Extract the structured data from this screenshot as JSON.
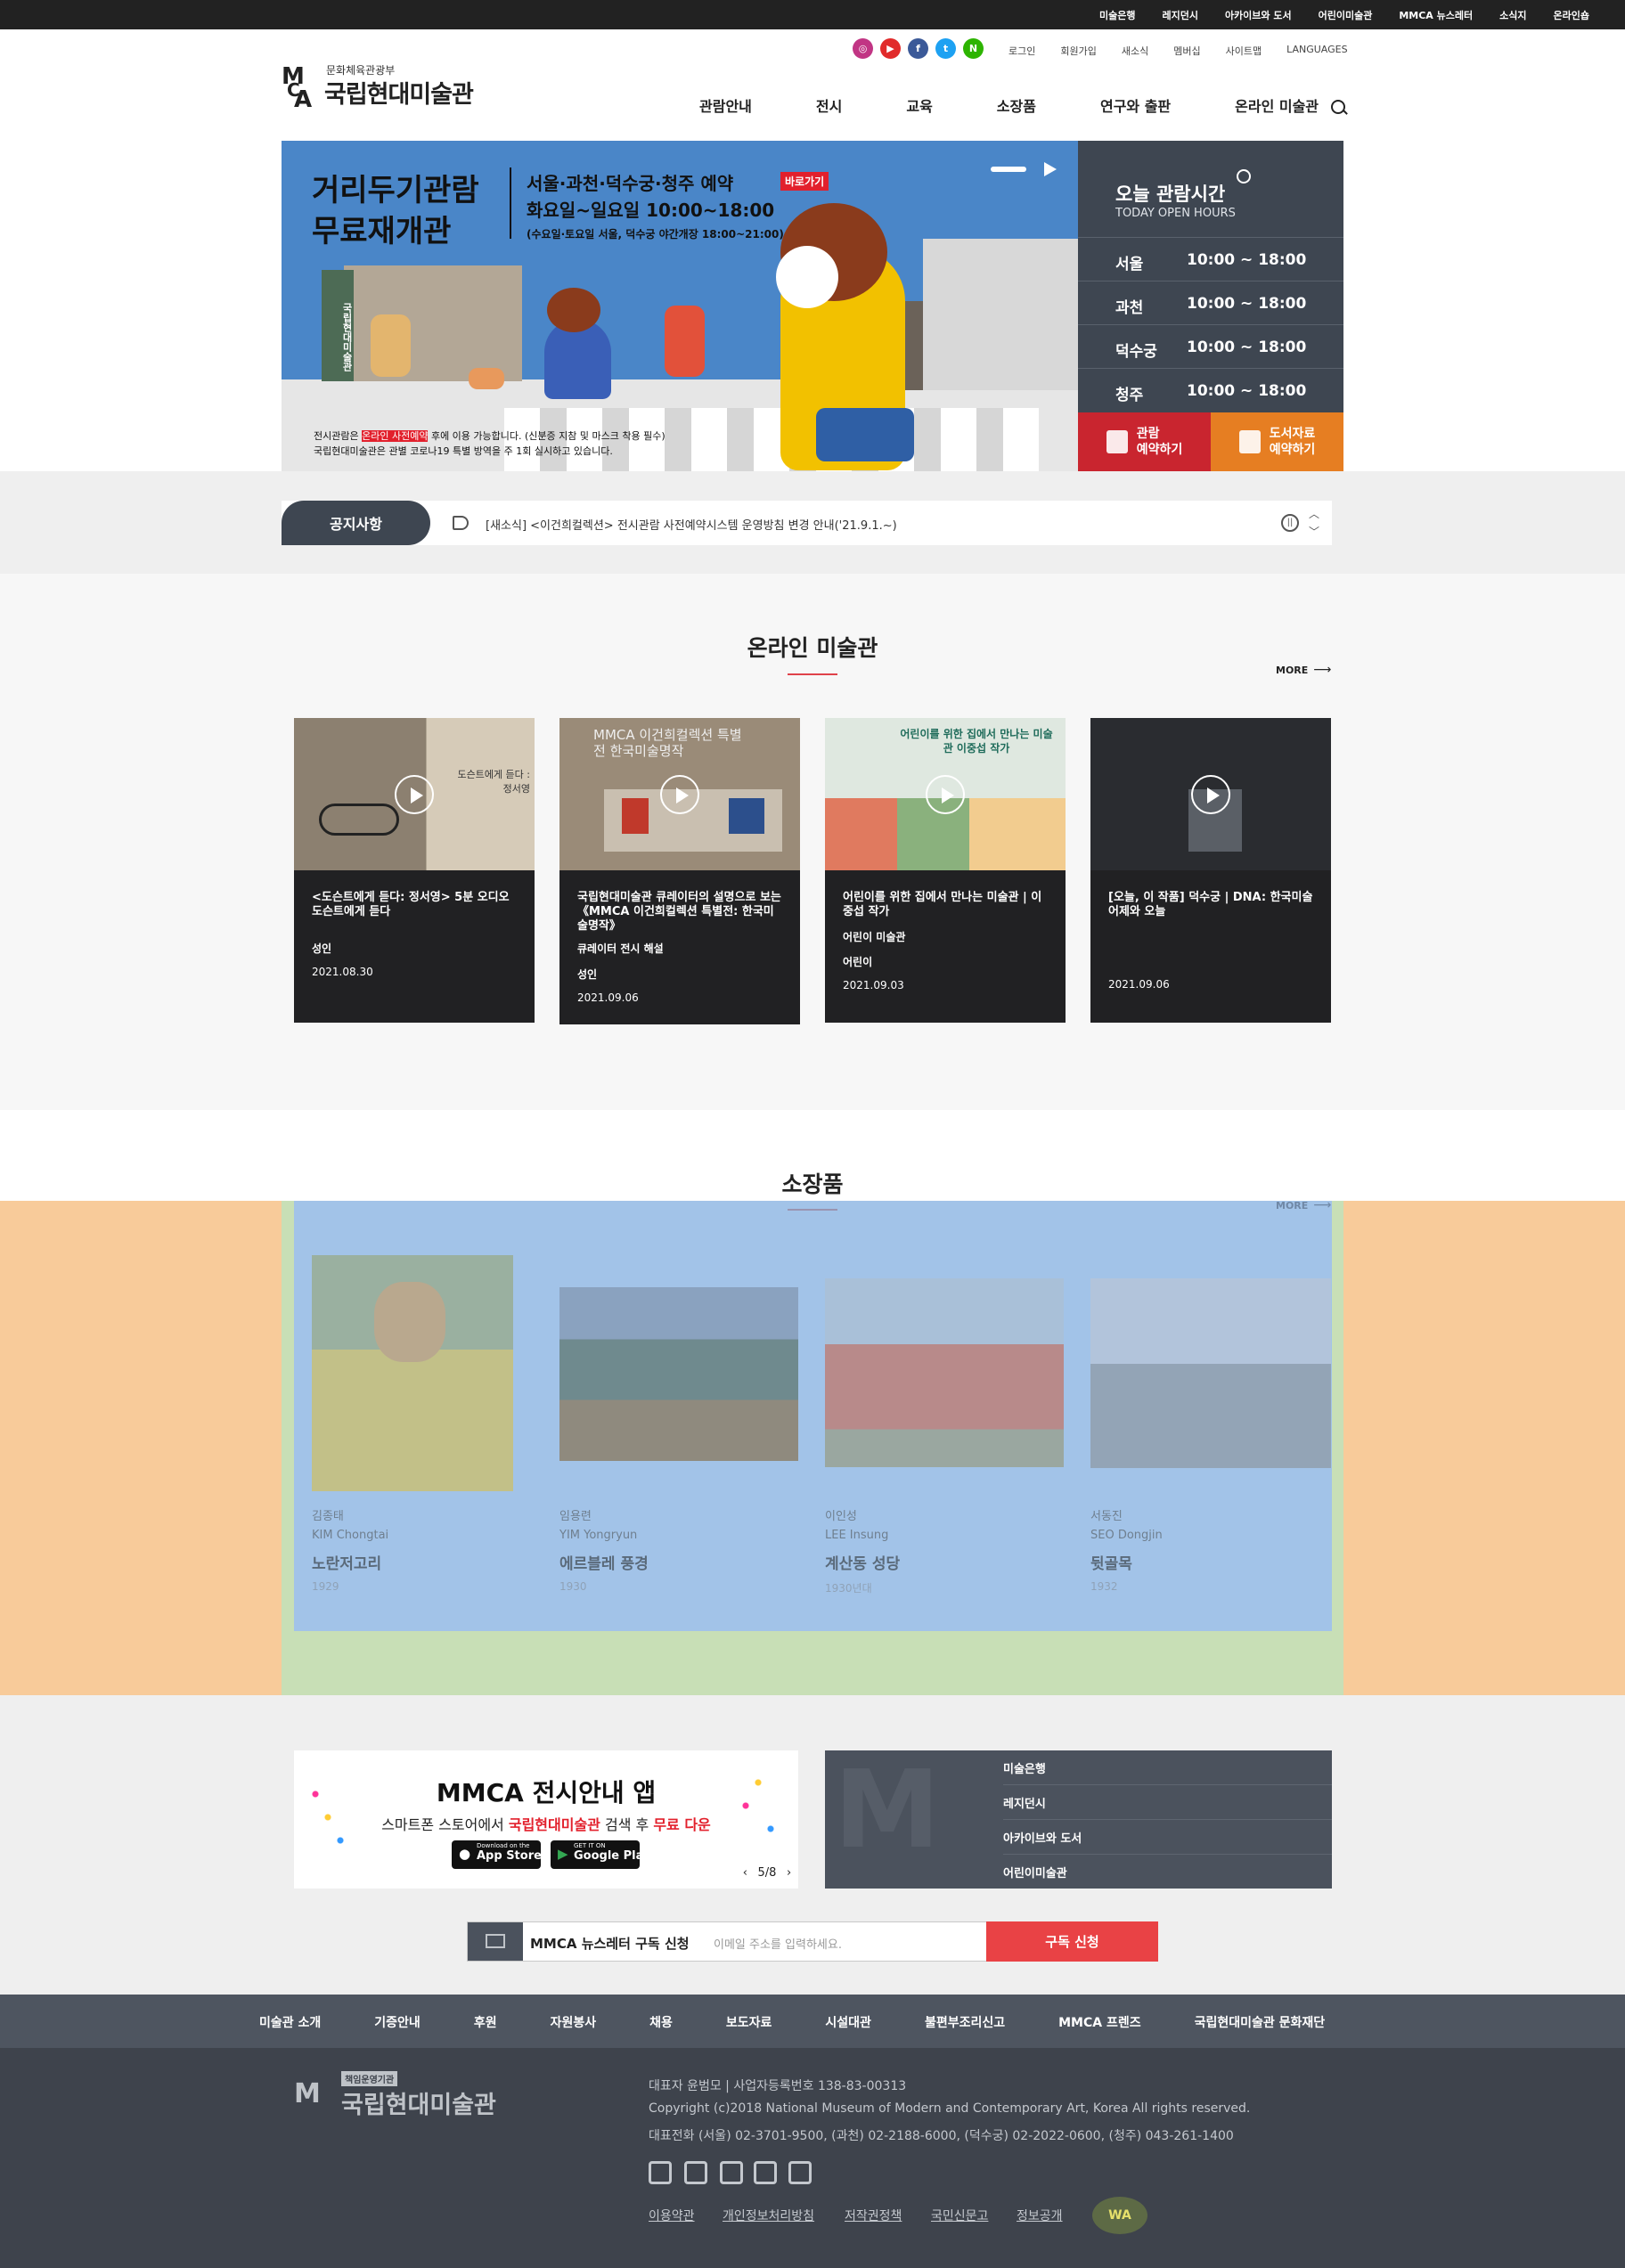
{
  "topbar": {
    "links": [
      "미술은행",
      "레지던시",
      "아카이브와 도서",
      "어린이미술관",
      "MMCA 뉴스레터",
      "소식지",
      "온라인숍"
    ]
  },
  "header": {
    "sns": [
      "instagram-icon",
      "youtube-icon",
      "facebook-icon",
      "twitter-icon",
      "naver-icon"
    ],
    "util": [
      "로그인",
      "회원가입",
      "새소식",
      "멤버십",
      "사이트맵",
      "LANGUAGES"
    ],
    "logo_sub": "문화체육관광부",
    "logo_name": "국립현대미술관",
    "gnb": [
      "관람안내",
      "전시",
      "교육",
      "소장품",
      "연구와 출판",
      "온라인 미술관"
    ]
  },
  "hero": {
    "title_line1": "거리두기관람",
    "title_line2": "무료재개관",
    "venues": "서울·과천·덕수궁·청주 예약",
    "shortcut": "바로가기",
    "days": "화요일~일요일 10:00~18:00",
    "night": "(수요일·토요일 서울, 덕수궁 야간개장 18:00~21:00)",
    "note1_a": "전시관람은 ",
    "note1_hl": "온라인 사전예약",
    "note1_b": " 후에 이용 가능합니다. (신분증 지참 및 마스크 착용 필수)",
    "note2": "국립현대미술관은 관별 코로나19 특별 방역을 주 1회 실시하고 있습니다.",
    "sign": "국립현대미술관"
  },
  "hours": {
    "title": "오늘 관람시간",
    "sub": "TODAY OPEN HOURS",
    "rows": [
      {
        "k": "서울",
        "v": "10:00 ~ 18:00"
      },
      {
        "k": "과천",
        "v": "10:00 ~ 18:00"
      },
      {
        "k": "덕수궁",
        "v": "10:00 ~ 18:00"
      },
      {
        "k": "청주",
        "v": "10:00 ~ 18:00"
      }
    ],
    "btn1_l1": "관람",
    "btn1_l2": "예약하기",
    "btn2_l1": "도서자료",
    "btn2_l2": "예약하기"
  },
  "notice": {
    "tag": "공지사항",
    "text": "[새소식] <이건희컬렉션> 전시관람 사전예약시스템 운영방침 변경 안내('21.9.1.~)"
  },
  "online": {
    "title": "온라인 미술관",
    "more": "MORE",
    "cards": [
      {
        "title": "<도슨트에게 듣다: 정서영> 5분 오디오 도슨트에게 듣다",
        "meta1": "성인",
        "meta2": "",
        "date": "2021.08.30",
        "thumb_text": "도슨트에게 듣다 : 정서영"
      },
      {
        "title": "국립현대미술관 큐레이터의 설명으로 보는 《MMCA 이건희컬렉션 특별전: 한국미술명작》",
        "meta1": "큐레이터 전시 해설",
        "meta2": "성인",
        "date": "2021.09.06",
        "thumb_text": "MMCA 이건희컬렉션 특별전 한국미술명작"
      },
      {
        "title": "어린이를 위한 집에서 만나는 미술관 | 이중섭 작가",
        "meta1": "어린이 미술관",
        "meta2": "어린이",
        "date": "2021.09.03",
        "thumb_text": "어린이를 위한 집에서 만나는 미술관 이중섭 작가"
      },
      {
        "title": "[오늘, 이 작품] 덕수궁 | DNA: 한국미술 어제와 오늘",
        "meta1": "",
        "meta2": "",
        "date": "2021.09.06",
        "thumb_text": ""
      }
    ]
  },
  "collection": {
    "title": "소장품",
    "more": "MORE",
    "items": [
      {
        "artist_ko": "김종태",
        "artist_en": "KIM Chongtai",
        "title": "노란저고리",
        "year": "1929"
      },
      {
        "artist_ko": "임용련",
        "artist_en": "YIM Yongryun",
        "title": "에르블레 풍경",
        "year": "1930"
      },
      {
        "artist_ko": "이인성",
        "artist_en": "LEE Insung",
        "title": "계산동 성당",
        "year": "1930년대"
      },
      {
        "artist_ko": "서동진",
        "artist_en": "SEO Dongjin",
        "title": "뒷골목",
        "year": "1932"
      }
    ]
  },
  "app_banner": {
    "title": "MMCA 전시안내 앱",
    "line_a": "스마트폰 스토어에서 ",
    "line_hl": "국립현대미술관",
    "line_b": " 검색 후 ",
    "line_hl2": "무료 다운",
    "appstore": "App Store",
    "googleplay": "Google Play",
    "appstore_small": "Download on the",
    "googleplay_small": "GET IT ON",
    "pager": "5/8"
  },
  "quick_links": [
    "미술은행",
    "레지던시",
    "아카이브와 도서",
    "어린이미술관"
  ],
  "newsletter": {
    "label": "MMCA 뉴스레터 구독 신청",
    "placeholder": "이메일 주소를 입력하세요.",
    "button": "구독 신청"
  },
  "footer_nav": [
    "미술관 소개",
    "기증안내",
    "후원",
    "자원봉사",
    "채용",
    "보도자료",
    "시설대관",
    "불편부조리신고",
    "MMCA 프렌즈",
    "국립현대미술관 문화재단"
  ],
  "footer": {
    "badge": "책임운영기관",
    "logo_name": "국립현대미술관",
    "info1": "대표자 윤범모 | 사업자등록번호 138-83-00313",
    "info2": "Copyright (c)2018 National Museum of Modern and Contemporary Art, Korea All rights reserved.",
    "info3": "대표전화 (서울) 02-3701-9500, (과천) 02-2188-6000, (덕수궁) 02-2022-0600, (청주) 043-261-1400",
    "social": [
      "instagram-icon",
      "youtube-icon",
      "facebook-icon",
      "twitter-icon",
      "naver-icon"
    ],
    "links": [
      "이용약관",
      "개인정보처리방침",
      "저작권정책",
      "국민신문고",
      "정보공개"
    ],
    "wa_mark": "WA"
  },
  "colors": {
    "accent": "#e0424a",
    "hours_bg": "#3e4651",
    "reserve_red": "#c9252f",
    "reserve_orange": "#e67e22"
  }
}
